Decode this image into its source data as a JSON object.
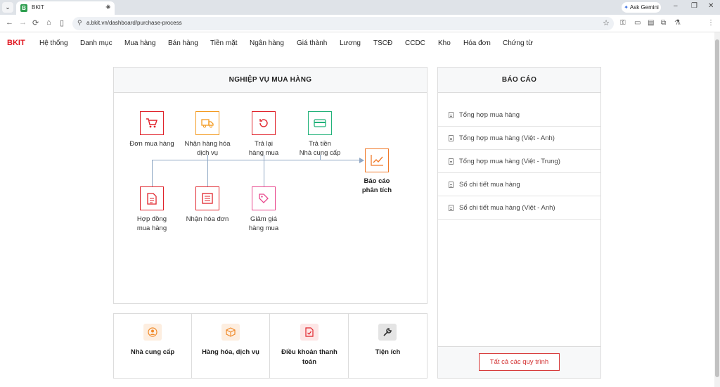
{
  "browser": {
    "tab_title": "BKIT",
    "tab_favicon": "B",
    "url": "a.bkit.vn/dashboard/purchase-process",
    "ask_gemini": "Ask Gemini"
  },
  "app": {
    "brand": "BKIT",
    "menu": [
      "Hệ thống",
      "Danh mục",
      "Mua hàng",
      "Bán hàng",
      "Tiền mặt",
      "Ngân hàng",
      "Giá thành",
      "Lương",
      "TSCĐ",
      "CCDC",
      "Kho",
      "Hóa đơn",
      "Chứng từ"
    ]
  },
  "process": {
    "title": "NGHIỆP VỤ MUA HÀNG",
    "top": [
      "Đơn mua hàng",
      "Nhận hàng hóa\ndịch vụ",
      "Trả lại\nhàng mua",
      "Trả tiền\nNhà cung cấp"
    ],
    "bottom": [
      "Hợp đồng\nmua hàng",
      "Nhận hóa đơn",
      "Giảm giá\nhàng mua"
    ],
    "report_node": "Báo cáo\nphân tích"
  },
  "reports": {
    "title": "BÁO CÁO",
    "items": [
      "Tổng hợp mua hàng",
      "Tổng hợp mua hàng (Việt - Anh)",
      "Tổng hợp mua hàng (Việt - Trung)",
      "Sổ chi tiết mua hàng",
      "Sổ chi tiết mua hàng (Việt - Anh)"
    ],
    "all_button": "Tất cả các quy trình"
  },
  "tiles": [
    "Nhà cung cấp",
    "Hàng hóa, dịch vụ",
    "Điều khoản thanh toán",
    "Tiện ích"
  ],
  "colors": {
    "red": "#e0232b",
    "orange": "#f39a1f",
    "green": "#21b27a",
    "pink": "#e8458b",
    "chart": "#f07a2a",
    "line": "#8fa7c4"
  }
}
